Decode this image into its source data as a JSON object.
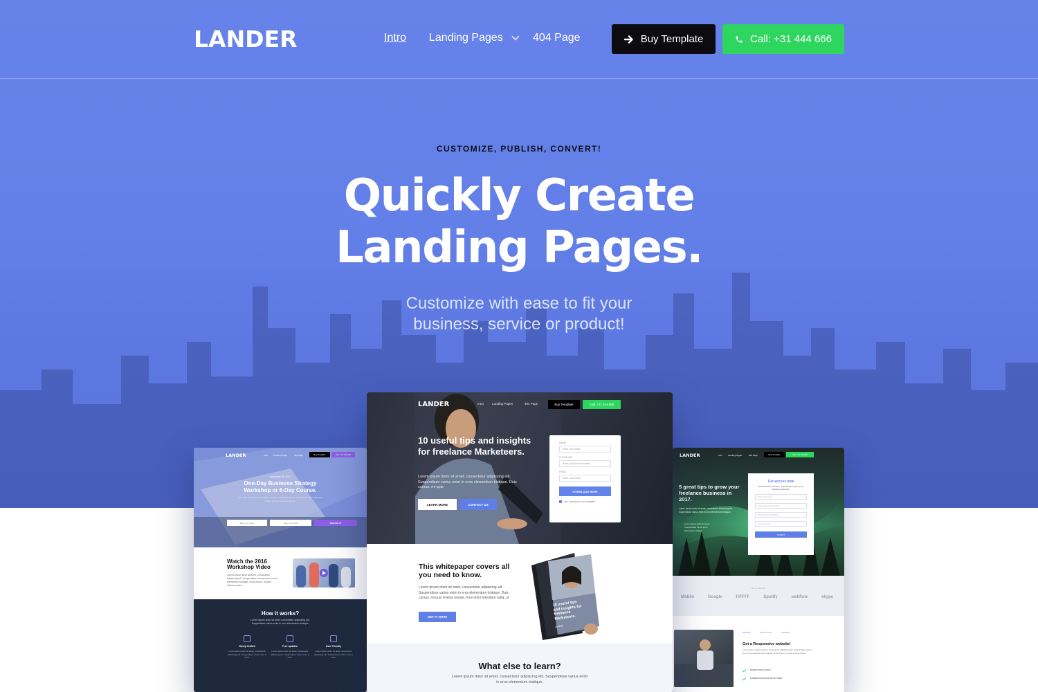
{
  "brand": {
    "logo_text": "LANDER"
  },
  "nav": {
    "links": [
      {
        "label": "Intro"
      },
      {
        "label": "Landing Pages"
      },
      {
        "label": "404 Page"
      }
    ],
    "buy_button": "Buy Template",
    "call_button": "Call: +31 444 666"
  },
  "hero": {
    "eyebrow": "CUSTOMIZE, PUBLISH, CONVERT!",
    "headline_line1": "Quickly Create",
    "headline_line2": "Landing Pages.",
    "subline_line1": "Customize with ease to fit your",
    "subline_line2": "business, service or product!"
  },
  "colors": {
    "hero_blue": "#6380e8",
    "buy_button_bg": "#0c0c10",
    "call_button_bg": "#2ed65f",
    "accent": "#5f7fe6"
  },
  "mockup_center": {
    "logo": "LANDER",
    "nav": [
      "Intro",
      "Landing Pages",
      "404 Page"
    ],
    "buy": "Buy Template",
    "call": "Call: +31 444 666",
    "title": "10 useful tips and insights for freelance Marketeers.",
    "copy": "Lorem ipsum dolor sit amet, consectetur adipiscing elit. Suspendisse varius enim in eros elementum tristique. Duis cursus, mi quis",
    "learn_more": "LEARN MORE",
    "contact_us": "CONTACT US",
    "form": {
      "name_label": "NAME",
      "name_placeholder": "Enter your name",
      "phone_label": "PHONE NR.",
      "phone_placeholder": "Enter your phone number",
      "email_label": "EMAIL",
      "email_placeholder": "Enter your email",
      "button": "DOWNLOAD NOW!",
      "checkbox": "Yes, subscribe to our newsletter"
    },
    "whitepaper_title": "This whitepaper covers all you need to know.",
    "whitepaper_copy": "Lorem ipsum dolor sit amet, consectetur adipiscing elit. Suspendisse varius enim in eros elementum tristique. Duis cursus, mi quis viverra ornare, eros dolor interdum nulla, ut",
    "get_it_now": "GET IT NOW!",
    "book_text": "10 useful tips and insights for freelance Marketeers.",
    "book_brand": "LANDER",
    "learn_title": "What else to learn?",
    "learn_copy": "Lorem ipsum dolor sit amet, consectetur adipiscing elit. Suspendisse varius enim in eros elementum tristique."
  },
  "mockup_left": {
    "logo": "LANDER",
    "nav": [
      "Intro",
      "Landing Pages",
      "404 Page"
    ],
    "buy": "Buy Template",
    "call": "Call: +31 444 666",
    "date": "December 04, 2017",
    "title": "One-Day Business Strategy Workshop or 6-Day Course.",
    "copy": "This page is perfect for a webinar, course or something similar. Present your info, video and images and get people to sign up.",
    "field1": "Enter your name",
    "field2": "Enter your email",
    "cta": "SIGN ME UP",
    "video_title": "Watch the 2016 Workshop Video",
    "video_copy": "Lorem ipsum dolor sit amet, consectetur adipiscing elit. Suspendisse varius enim in eros elementum tristique. Duis cursus, mi quis viverra ornare.",
    "how_title": "How it works?",
    "how_copy": "Lorem ipsum dolor sit amet, consectetur adipiscing elit. Suspendisse varius enim in eros elementum tristique.",
    "features": [
      {
        "title": "Nicely Crafted",
        "copy": "Lorem ipsum dolor sit amet, consectetur adipiscing elit. Suspendisse varius enim in eros."
      },
      {
        "title": "Free updates",
        "copy": "Lorem ipsum dolor sit amet, consectetur adipiscing elit. Suspendisse varius enim in eros."
      },
      {
        "title": "User Friendly",
        "copy": "Lorem ipsum dolor sit amet, consectetur adipiscing elit. Suspendisse varius enim in eros."
      }
    ]
  },
  "mockup_right": {
    "logo": "LANDER",
    "nav": [
      "Intro",
      "Landing Pages",
      "404 Page"
    ],
    "buy": "Buy Template",
    "call": "Call: +31 444 666",
    "title": "5 great tips to grow your freelance business in 2017.",
    "copy": "Lorem ipsum dolor sit amet, consectetur adipiscing elit. Suspendisse varius enim in eros elementum tristique.",
    "bullets": [
      "Lorem ipsum dolor sit amet",
      "Suspendisse varius enim",
      "Elementum tristique"
    ],
    "form_title": "Get access now",
    "form_sub": "Download the brochure \"5 great tips to grow your freelance business\".",
    "form_fields": [
      "Enter your name",
      "Enter your phone number",
      "Enter your email address",
      "Enter your city"
    ],
    "form_button": "SUBMIT",
    "trusted": "TRUSTED BY",
    "logos": [
      "Mobile",
      "Google",
      "FIFFFF",
      "Spotify",
      "webflow",
      "skype"
    ],
    "tabs": [
      "DESIGN",
      "ANALYTICS",
      "SEARCH"
    ],
    "section_title": "Get a Responsive website!",
    "section_copy": "Lorem ipsum dolor sit amet, consectetur adipiscing elit. Suspendisse varius enim in eros elementum tristique. Duis cursus, mi quis viverra ornare.",
    "checks": [
      "MOBILE SOLUTIONS",
      "LOREM IPSUM DOLOR SIT AMET"
    ]
  }
}
